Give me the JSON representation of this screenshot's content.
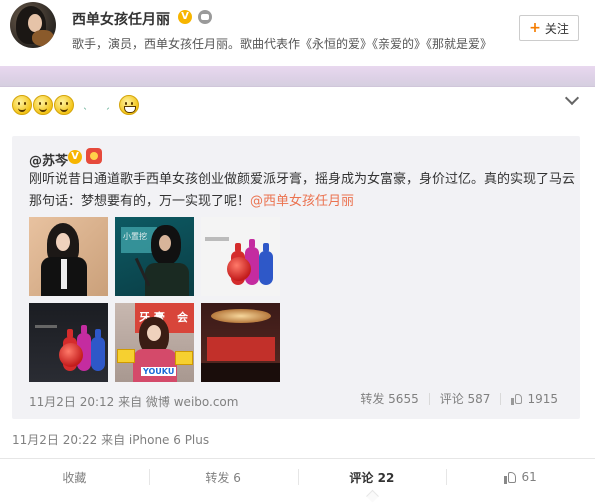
{
  "author": {
    "name": "西单女孩任月丽",
    "verified_badge": "V",
    "description": "歌手，演员，西单女孩任月丽。歌曲代表作《永恒的爱》《亲爱的》《那就是爱》"
  },
  "follow_button": {
    "plus": "+",
    "label": "关注"
  },
  "post": {
    "emoji": [
      "smile-emoji",
      "smile-emoji",
      "smile-emoji",
      "grin-emoji"
    ],
    "time_source": "11月2日 20:22 来自 iPhone 6 Plus"
  },
  "repost": {
    "user": "@苏芩",
    "verified_badge": "V",
    "text_main": "刚听说昔日通道歌手西单女孩创业做颜爱派牙膏，摇身成为女富豪，身价过亿。真的实现了马云那句话：梦想要有的，万一实现了呢！",
    "mention": "@西单女孩任月丽",
    "time_source": "11月2日 20:12 来自 微博 weibo.com",
    "reposts": "转发 5655",
    "comments": "评论 587",
    "likes": "1915",
    "thumb_texts": {
      "t2_sign": "小置挖",
      "t5_banner": "牙 膏",
      "t5_banner2": "会",
      "t5_logo": "YOUKU"
    }
  },
  "actions": {
    "favorite": "收藏",
    "repost": "转发 6",
    "comment": "评论 22",
    "like": "61"
  },
  "colors": {
    "accent": "#eb7350",
    "verified": "#f7b500",
    "banner": "#e2d4ea",
    "repost_bg": "#f2f2f5"
  }
}
